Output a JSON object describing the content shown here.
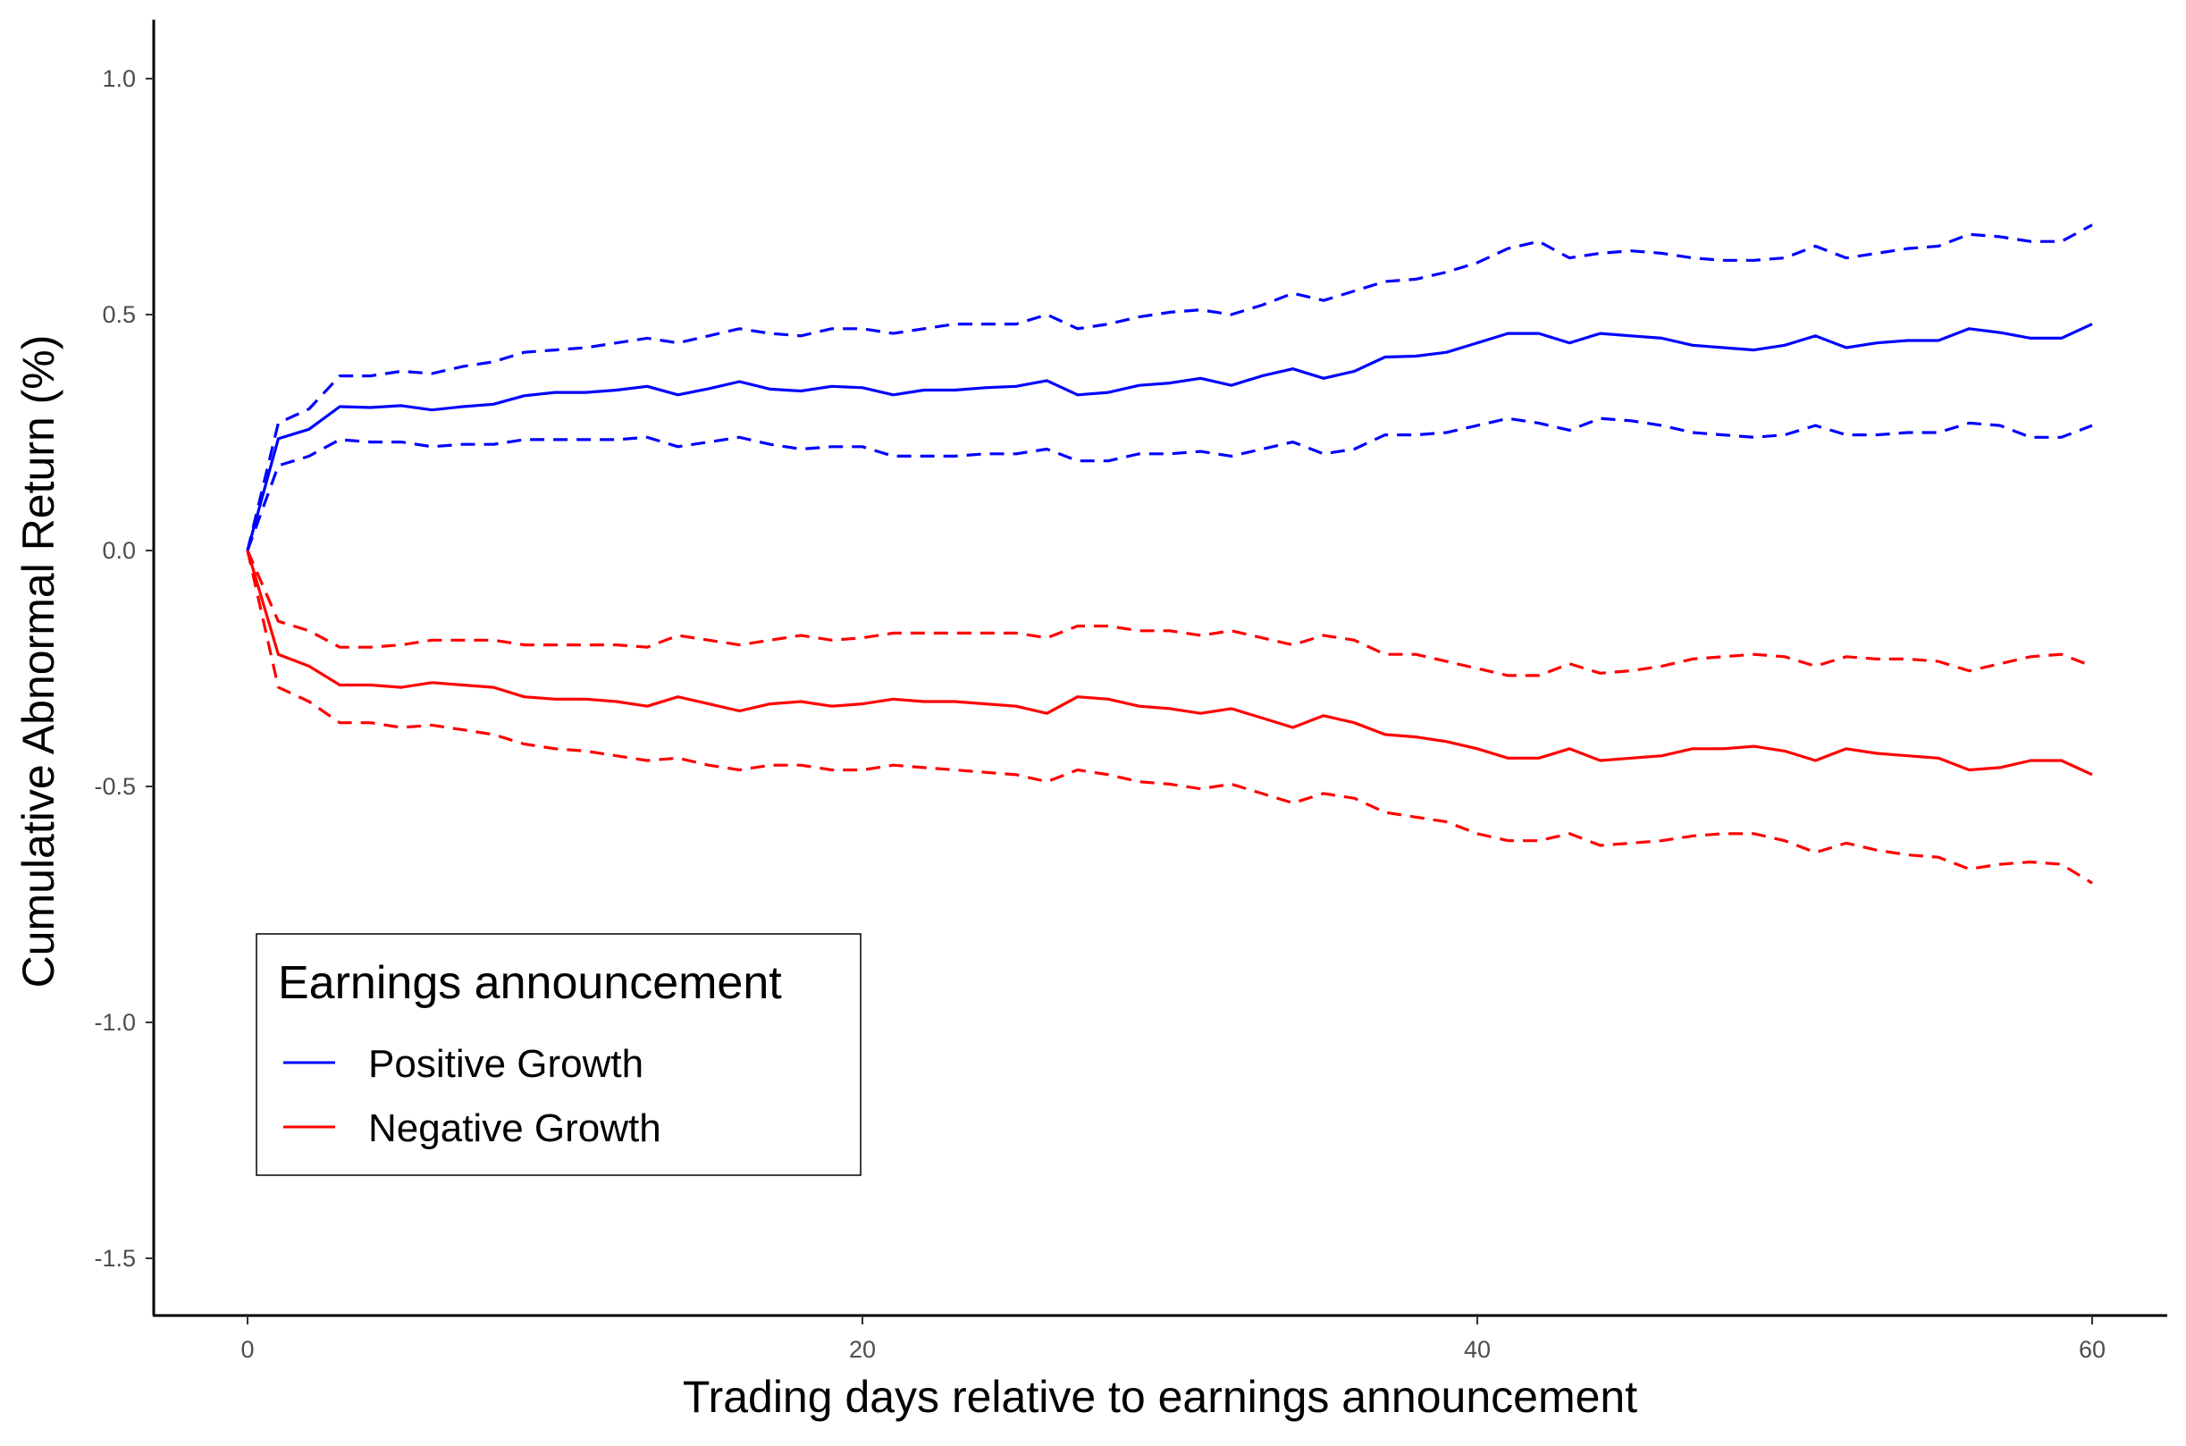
{
  "chart_data": {
    "type": "line",
    "title": "",
    "xlabel": "Trading days relative to earnings announcement",
    "ylabel": "Cumulative Abnormal Return (%)",
    "xlim": [
      -3,
      63.5
    ],
    "ylim": [
      -1.62,
      1.12
    ],
    "x_ticks": [
      0,
      20,
      40,
      60
    ],
    "x_tick_labels": [
      "0",
      "20",
      "40",
      "60"
    ],
    "y_ticks": [
      1.0,
      0.5,
      0.0,
      -0.5,
      -1.0,
      -1.5
    ],
    "y_tick_labels": [
      "1.0",
      "0.5",
      "0.0",
      "-0.5",
      "-1.0",
      "-1.5"
    ],
    "grid": false,
    "legend": {
      "title": "Earnings announcement",
      "placement": "bottom-left",
      "entries": [
        {
          "label": "Positive Growth",
          "color": "#0000ff"
        },
        {
          "label": "Negative Growth",
          "color": "#ff0000"
        }
      ]
    },
    "x": [
      0,
      1,
      2,
      3,
      4,
      5,
      6,
      7,
      8,
      9,
      10,
      11,
      12,
      13,
      14,
      15,
      16,
      17,
      18,
      19,
      20,
      21,
      22,
      23,
      24,
      25,
      26,
      27,
      28,
      29,
      30,
      31,
      32,
      33,
      34,
      35,
      36,
      37,
      38,
      39,
      40,
      41,
      42,
      43,
      44,
      45,
      46,
      47,
      48,
      49,
      50,
      51,
      52,
      53,
      54,
      55,
      56,
      57,
      58,
      59,
      60
    ],
    "series": [
      {
        "name": "Positive Growth",
        "color": "#0000ff",
        "style": "solid",
        "values": [
          0,
          0.237,
          0.257,
          0.305,
          0.303,
          0.307,
          0.298,
          0.305,
          0.31,
          0.328,
          0.335,
          0.335,
          0.34,
          0.348,
          0.33,
          0.343,
          0.358,
          0.342,
          0.338,
          0.348,
          0.345,
          0.33,
          0.34,
          0.34,
          0.345,
          0.348,
          0.36,
          0.33,
          0.335,
          0.35,
          0.355,
          0.365,
          0.35,
          0.37,
          0.385,
          0.365,
          0.38,
          0.41,
          0.412,
          0.42,
          0.44,
          0.46,
          0.46,
          0.44,
          0.46,
          0.455,
          0.45,
          0.435,
          0.43,
          0.425,
          0.435,
          0.455,
          0.43,
          0.44,
          0.445,
          0.445,
          0.47,
          0.462,
          0.45,
          0.45,
          0.48
        ]
      },
      {
        "name": "Positive Growth upper CI",
        "color": "#0000ff",
        "style": "dashed",
        "values": [
          0,
          0.27,
          0.3,
          0.37,
          0.37,
          0.38,
          0.375,
          0.39,
          0.4,
          0.42,
          0.425,
          0.43,
          0.44,
          0.45,
          0.44,
          0.455,
          0.47,
          0.46,
          0.455,
          0.47,
          0.47,
          0.46,
          0.47,
          0.48,
          0.48,
          0.48,
          0.5,
          0.47,
          0.48,
          0.495,
          0.505,
          0.51,
          0.5,
          0.52,
          0.545,
          0.53,
          0.55,
          0.57,
          0.575,
          0.59,
          0.61,
          0.64,
          0.655,
          0.62,
          0.63,
          0.635,
          0.63,
          0.62,
          0.615,
          0.615,
          0.62,
          0.645,
          0.62,
          0.63,
          0.64,
          0.645,
          0.67,
          0.665,
          0.655,
          0.655,
          0.69
        ]
      },
      {
        "name": "Positive Growth lower CI",
        "color": "#0000ff",
        "style": "dashed",
        "values": [
          0,
          0.18,
          0.2,
          0.235,
          0.23,
          0.23,
          0.22,
          0.225,
          0.225,
          0.235,
          0.235,
          0.235,
          0.235,
          0.24,
          0.22,
          0.23,
          0.24,
          0.225,
          0.215,
          0.22,
          0.22,
          0.2,
          0.2,
          0.2,
          0.205,
          0.205,
          0.215,
          0.19,
          0.19,
          0.205,
          0.205,
          0.21,
          0.2,
          0.215,
          0.23,
          0.205,
          0.215,
          0.245,
          0.245,
          0.25,
          0.265,
          0.28,
          0.27,
          0.255,
          0.28,
          0.275,
          0.265,
          0.25,
          0.245,
          0.24,
          0.245,
          0.265,
          0.245,
          0.245,
          0.25,
          0.25,
          0.27,
          0.265,
          0.24,
          0.24,
          0.265
        ]
      },
      {
        "name": "Negative Growth",
        "color": "#ff0000",
        "style": "solid",
        "values": [
          0,
          -0.22,
          -0.245,
          -0.285,
          -0.285,
          -0.29,
          -0.28,
          -0.285,
          -0.29,
          -0.31,
          -0.315,
          -0.315,
          -0.32,
          -0.33,
          -0.31,
          -0.325,
          -0.34,
          -0.325,
          -0.32,
          -0.33,
          -0.325,
          -0.315,
          -0.32,
          -0.32,
          -0.325,
          -0.33,
          -0.345,
          -0.31,
          -0.315,
          -0.33,
          -0.335,
          -0.345,
          -0.335,
          -0.355,
          -0.375,
          -0.35,
          -0.365,
          -0.39,
          -0.395,
          -0.405,
          -0.42,
          -0.44,
          -0.44,
          -0.42,
          -0.445,
          -0.44,
          -0.435,
          -0.42,
          -0.42,
          -0.415,
          -0.425,
          -0.445,
          -0.42,
          -0.43,
          -0.435,
          -0.44,
          -0.465,
          -0.46,
          -0.445,
          -0.445,
          -0.475
        ]
      },
      {
        "name": "Negative Growth upper CI",
        "color": "#ff0000",
        "style": "dashed",
        "values": [
          0,
          -0.15,
          -0.17,
          -0.205,
          -0.205,
          -0.2,
          -0.19,
          -0.19,
          -0.19,
          -0.2,
          -0.2,
          -0.2,
          -0.2,
          -0.205,
          -0.18,
          -0.19,
          -0.2,
          -0.19,
          -0.18,
          -0.19,
          -0.185,
          -0.175,
          -0.175,
          -0.175,
          -0.175,
          -0.175,
          -0.185,
          -0.16,
          -0.16,
          -0.17,
          -0.17,
          -0.18,
          -0.17,
          -0.185,
          -0.2,
          -0.18,
          -0.19,
          -0.22,
          -0.22,
          -0.235,
          -0.25,
          -0.265,
          -0.265,
          -0.24,
          -0.26,
          -0.255,
          -0.245,
          -0.23,
          -0.225,
          -0.22,
          -0.225,
          -0.245,
          -0.225,
          -0.23,
          -0.23,
          -0.235,
          -0.255,
          -0.24,
          -0.225,
          -0.22,
          -0.245
        ]
      },
      {
        "name": "Negative Growth lower CI",
        "color": "#ff0000",
        "style": "dashed",
        "values": [
          0,
          -0.29,
          -0.32,
          -0.365,
          -0.365,
          -0.375,
          -0.37,
          -0.38,
          -0.39,
          -0.41,
          -0.42,
          -0.425,
          -0.435,
          -0.445,
          -0.44,
          -0.455,
          -0.465,
          -0.455,
          -0.455,
          -0.465,
          -0.465,
          -0.455,
          -0.46,
          -0.465,
          -0.47,
          -0.475,
          -0.49,
          -0.465,
          -0.475,
          -0.49,
          -0.495,
          -0.505,
          -0.495,
          -0.515,
          -0.535,
          -0.515,
          -0.525,
          -0.555,
          -0.565,
          -0.575,
          -0.6,
          -0.615,
          -0.615,
          -0.6,
          -0.625,
          -0.62,
          -0.615,
          -0.605,
          -0.6,
          -0.6,
          -0.615,
          -0.64,
          -0.62,
          -0.635,
          -0.645,
          -0.65,
          -0.675,
          -0.665,
          -0.66,
          -0.665,
          -0.705
        ]
      }
    ]
  }
}
